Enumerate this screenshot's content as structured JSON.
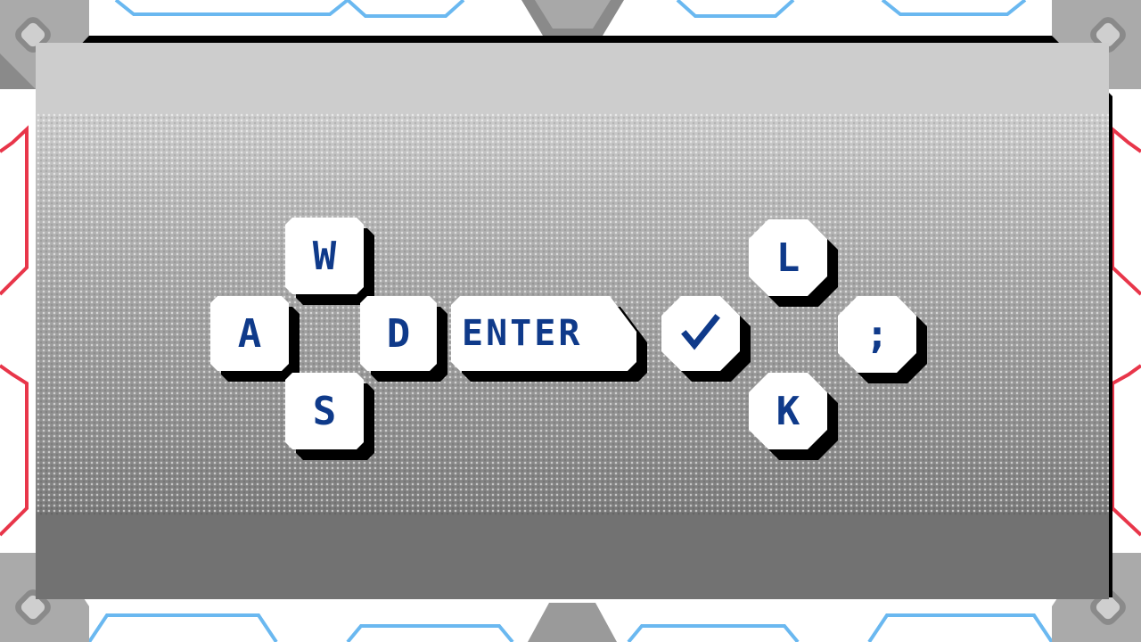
{
  "colors": {
    "key_text": "#0f3a8a",
    "key_face": "#ffffff",
    "key_shadow": "#000000",
    "accent_red": "#e8364a",
    "accent_blue": "#6ab8f0",
    "frame_gray": "#9a9a9a"
  },
  "keys": {
    "w": "W",
    "a": "A",
    "s": "S",
    "d": "D",
    "enter": "ENTER",
    "confirm_icon": "check-icon",
    "l": "L",
    "k": "K",
    "semicolon": ";"
  }
}
